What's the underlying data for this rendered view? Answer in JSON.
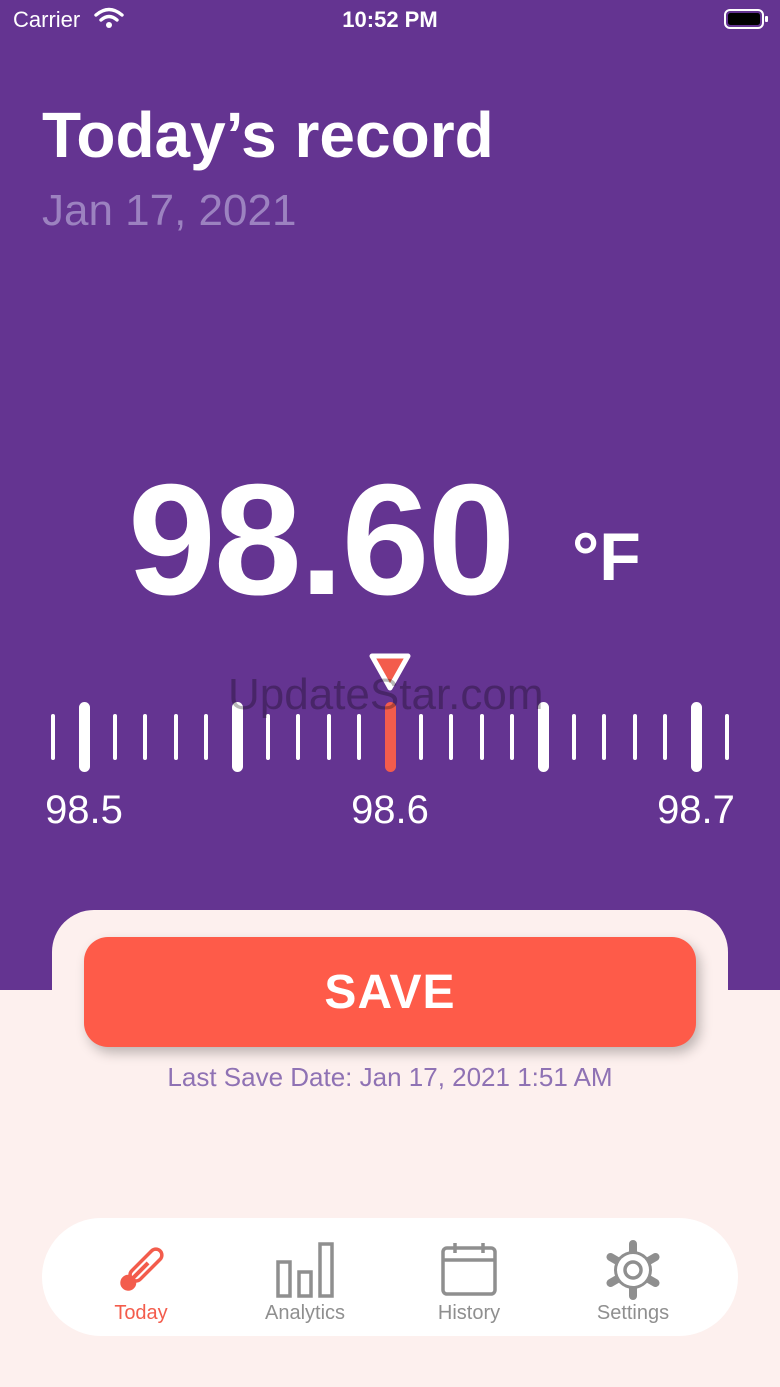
{
  "status_bar": {
    "carrier": "Carrier",
    "time": "10:52 PM"
  },
  "header": {
    "title": "Today’s record",
    "date": "Jan 17, 2021"
  },
  "reading": {
    "value": "98.60",
    "unit": "°F"
  },
  "ruler": {
    "labels": [
      "98.5",
      "98.6",
      "98.7"
    ],
    "selected": "98.6"
  },
  "watermark": "UpdateStar.com",
  "actions": {
    "save_label": "SAVE",
    "last_save": "Last Save Date: Jan 17, 2021 1:51 AM"
  },
  "tabs": [
    {
      "label": "Today",
      "icon": "thermometer-icon",
      "active": true
    },
    {
      "label": "Analytics",
      "icon": "bar-chart-icon",
      "active": false
    },
    {
      "label": "History",
      "icon": "calendar-icon",
      "active": false
    },
    {
      "label": "Settings",
      "icon": "gear-icon",
      "active": false
    }
  ],
  "colors": {
    "header_bg": "#643491",
    "accent": "#fe5b49",
    "page_bg": "#fdf0ee",
    "muted_text": "#8f72b4"
  }
}
